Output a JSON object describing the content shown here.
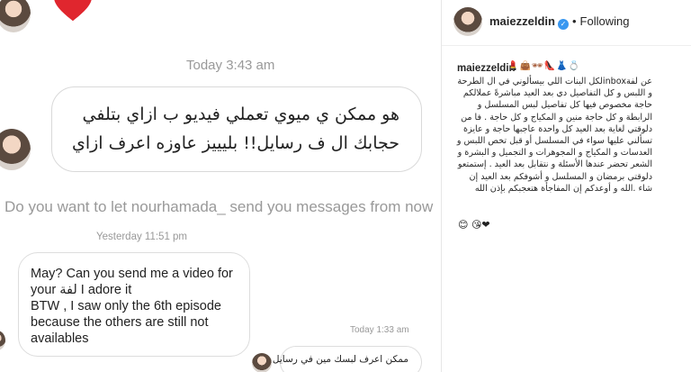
{
  "dm": {
    "timestamp_top": "Today 3:43 am",
    "arabic_message": "هو ممكن ي ميوي تعملي فيديو ب ازاي بتلفي حجابك ال ف رسايل!! بليييز عاوزه اعرف ازاي",
    "request_prompt": "Do you want to let nourhamada_ send you messages from now",
    "timestamp_yesterday": "Yesterday 11:51 pm",
    "english_message": "May? Can you send me a video for your لفة I adore it\nBTW , I saw only the 6th episode because the others are still not availables",
    "timestamp_reply": "Today 1:33 am",
    "reply_message": "ممكن اعرف لبسك مين في رسايل"
  },
  "post": {
    "username": "maiezzeldin",
    "verified_glyph": "✓",
    "follow_label": "Following",
    "separator": "•",
    "caption_user": "maiezzeldin",
    "caption_emojis": "💄👜🕶👠👗💍",
    "caption_text": "عن لفةinboxلكل البنات اللي بيسألوني في ال الطرحة و اللبس و كل التفاصيل دي بعد العيد مباشرةً عملالكم حاجة مخصوص فيها كل تفاصيل لبس المسلسل و الرابطة و كل حاجة منين و المكياج و كل حاجة . فا من دلوقتي لغاية بعد العيد كل واحدة عاجبها حاجة و عايزة تسألني عليها سواء في المسلسل أو قبل تخص اللبس و العدسات و المكياج و المجوهرات و التجميل و البشرة و الشعر تحضر عندها الأسئلة و نتقابل بعد العيد . إستمتعو دلوقتي برمضان و المسلسل و أشوفكم بعد العيد إن شاء .الله و أوعدكم إن المفاجأة هتعجبكم بإذن الله",
    "caption_end_emojis": "😊 😘❤"
  }
}
